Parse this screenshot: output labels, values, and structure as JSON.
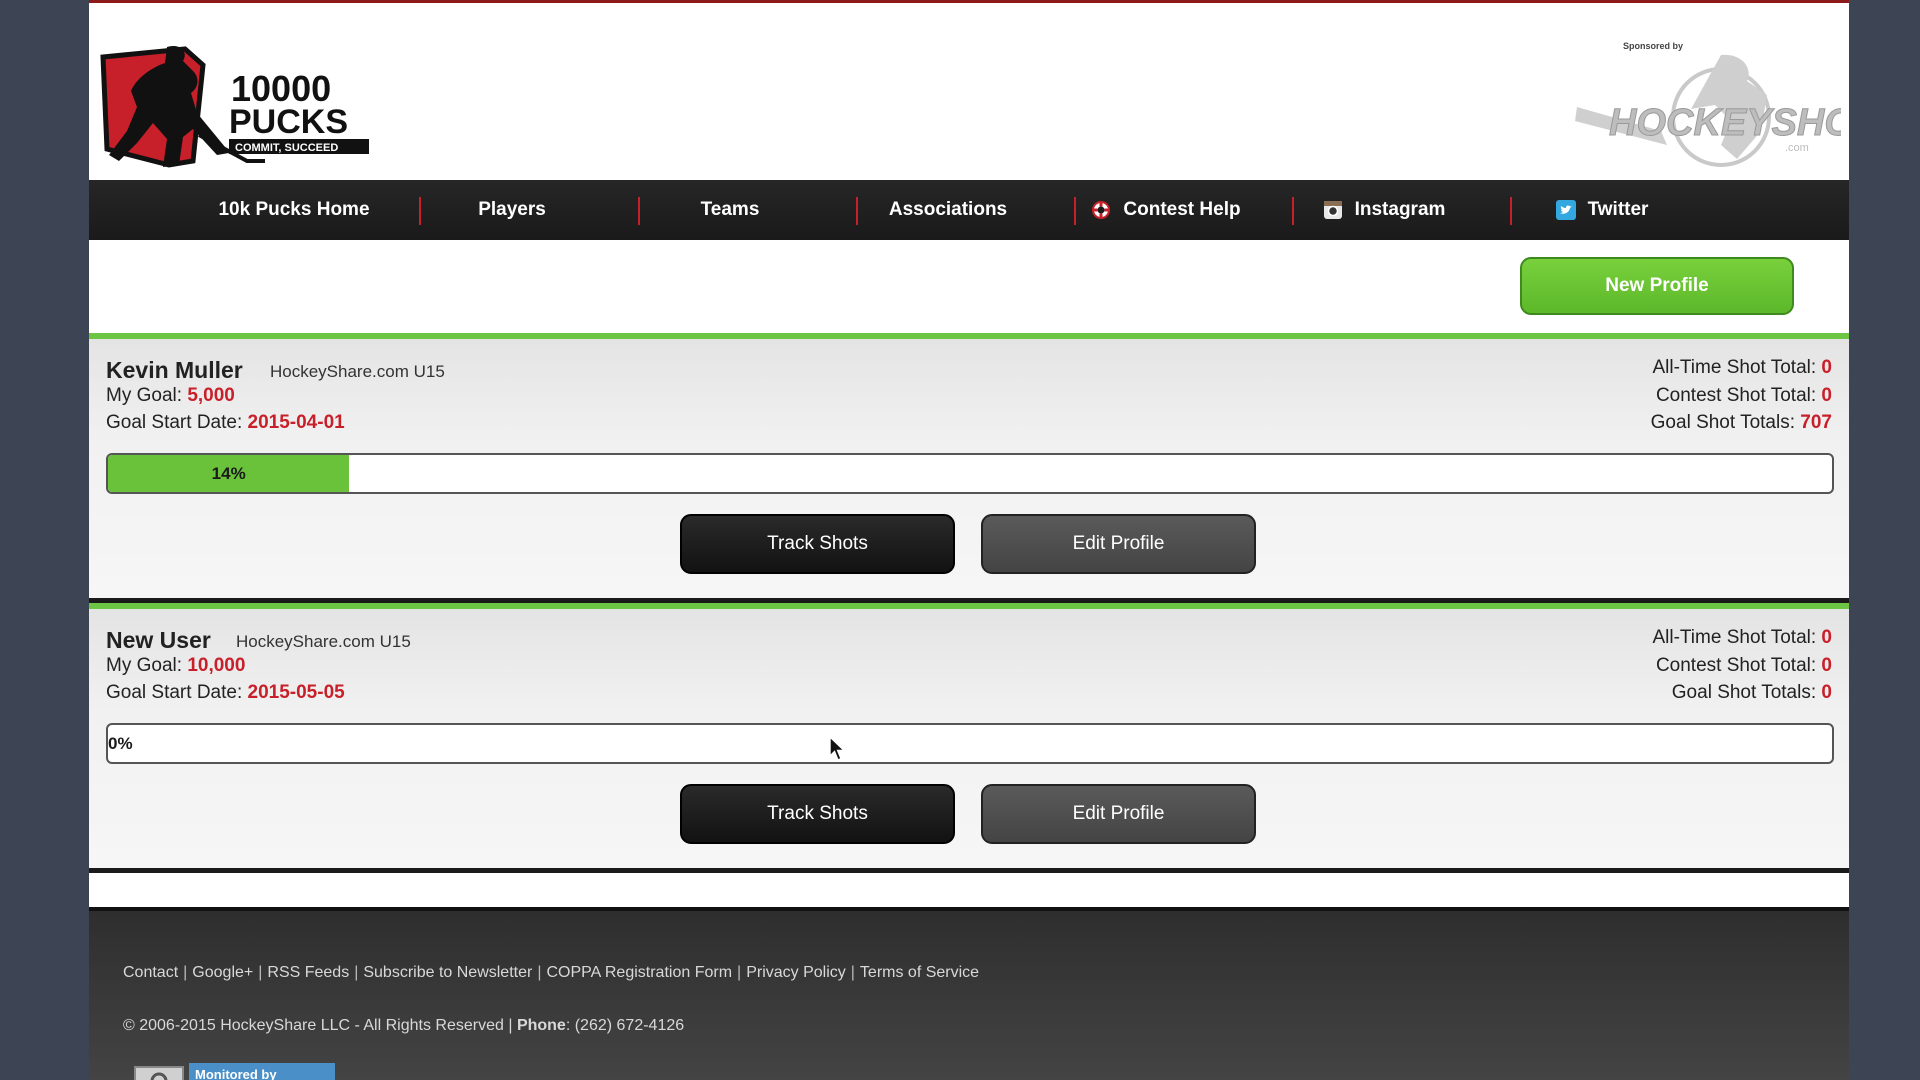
{
  "brand": {
    "logo_line1": "10000",
    "logo_line2": "PUCKS",
    "logo_tagline": "COMMIT, SUCCEED",
    "sponsored_by": "Sponsored by",
    "sponsor_name": "HOCKEYSHOT",
    "sponsor_domain": ".com"
  },
  "nav": {
    "items": [
      {
        "label": "10k Pucks Home",
        "icon": ""
      },
      {
        "label": "Players",
        "icon": ""
      },
      {
        "label": "Teams",
        "icon": ""
      },
      {
        "label": "Associations",
        "icon": ""
      },
      {
        "label": "Contest Help",
        "icon": "lifebuoy-icon"
      },
      {
        "label": "Instagram",
        "icon": "instagram-icon"
      },
      {
        "label": "Twitter",
        "icon": "twitter-icon"
      }
    ]
  },
  "actions": {
    "new_profile": "New Profile"
  },
  "labels": {
    "my_goal": "My Goal:",
    "goal_start_date": "Goal Start Date:",
    "all_time_total": "All-Time Shot Total:",
    "contest_total": "Contest Shot Total:",
    "goal_totals": "Goal Shot Totals:",
    "track_shots": "Track Shots",
    "edit_profile": "Edit Profile"
  },
  "profiles": [
    {
      "name": "Kevin Muller",
      "team": "HockeyShare.com U15",
      "goal": "5,000",
      "start_date": "2015-04-01",
      "all_time_total": "0",
      "contest_total": "0",
      "goal_totals": "707",
      "progress_label": "14%",
      "progress_fraction": 0.14
    },
    {
      "name": "New User",
      "team": "HockeyShare.com U15",
      "goal": "10,000",
      "start_date": "2015-05-05",
      "all_time_total": "0",
      "contest_total": "0",
      "goal_totals": "0",
      "progress_label": "0%",
      "progress_fraction": 0
    }
  ],
  "footer": {
    "links": [
      "Contact",
      "Google+",
      "RSS Feeds",
      "Subscribe to Newsletter",
      "COPPA Registration Form",
      "Privacy Policy",
      "Terms of Service"
    ],
    "copyright": "© 2006-2015 HockeyShare LLC - All Rights Reserved |",
    "phone_label": "Phone",
    "phone": ": (262) 672-4126",
    "monitor_badge": "Monitored by"
  },
  "colors": {
    "accent_red": "#c8202a",
    "accent_green": "#6cc644",
    "nav_bg": "#1a1a1a"
  }
}
